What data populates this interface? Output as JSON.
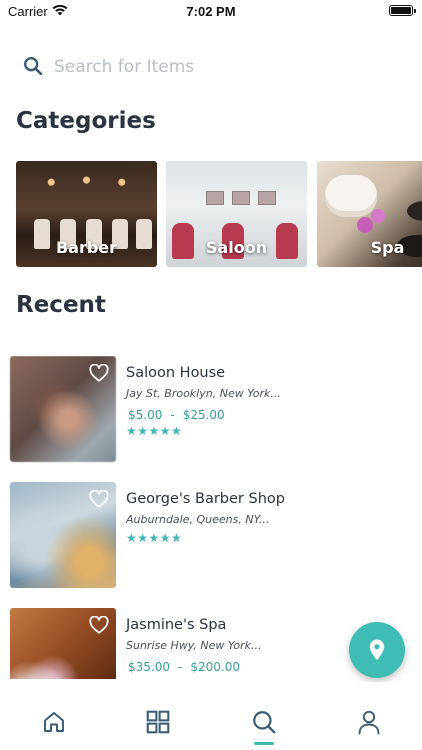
{
  "status_bar": {
    "carrier": "Carrier",
    "time": "7:02 PM"
  },
  "search": {
    "placeholder": "Search for Items",
    "icon": "search-icon"
  },
  "categories": {
    "title": "Categories",
    "items": [
      {
        "label": "Barber"
      },
      {
        "label": "Saloon"
      },
      {
        "label": "Spa"
      }
    ]
  },
  "recent": {
    "title": "Recent",
    "items": [
      {
        "name": "Saloon House",
        "address": "Jay St, Brooklyn, New York...",
        "price_min": "$5.00",
        "price_max": "$25.00",
        "rating": 5
      },
      {
        "name": "George's Barber Shop",
        "address": "Auburndale, Queens, NY...",
        "rating": 5
      },
      {
        "name": "Jasmine's Spa",
        "address": "Sunrise Hwy, New York...",
        "price_min": "$35.00",
        "price_max": "$200.00"
      }
    ],
    "price_separator": "-"
  },
  "fab": {
    "icon": "map-pin-icon"
  },
  "tab_bar": {
    "tabs": [
      {
        "name": "home",
        "icon": "home-icon"
      },
      {
        "name": "categories",
        "icon": "grid-icon"
      },
      {
        "name": "search",
        "icon": "search-icon",
        "active": true
      },
      {
        "name": "profile",
        "icon": "user-icon"
      }
    ]
  },
  "colors": {
    "accent": "#3fbcb4",
    "text": "#2b3340",
    "price": "#3a9f97",
    "placeholder": "#b9bec6"
  }
}
